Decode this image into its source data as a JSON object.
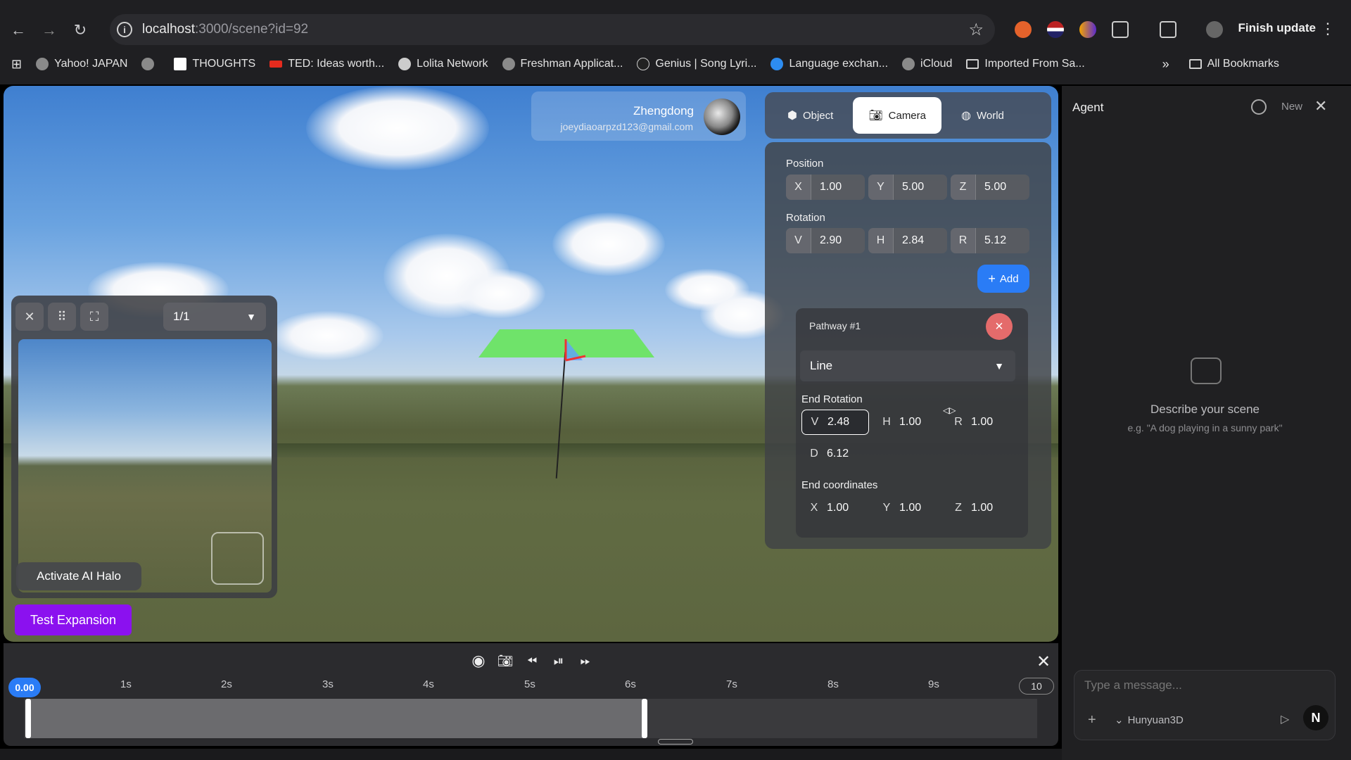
{
  "browser": {
    "url_host": "localhost",
    "url_path": ":3000/scene?id=92",
    "finish_update": "Finish update",
    "bookmarks": [
      {
        "label": "Yahoo! JAPAN"
      },
      {
        "label": "THOUGHTS"
      },
      {
        "label": "TED: Ideas worth..."
      },
      {
        "label": "Lolita Network"
      },
      {
        "label": "Freshman Applicat..."
      },
      {
        "label": "Genius | Song Lyri..."
      },
      {
        "label": "Language exchan..."
      },
      {
        "label": "iCloud"
      },
      {
        "label": "Imported From Sa..."
      }
    ],
    "all_bookmarks": "All Bookmarks"
  },
  "user": {
    "name": "Zhengdong",
    "email": "joeydiaoarpzd123@gmail.com"
  },
  "tabs": [
    {
      "label": "Object",
      "icon": "cube-icon"
    },
    {
      "label": "Camera",
      "icon": "camera-icon"
    },
    {
      "label": "World",
      "icon": "globe-icon"
    }
  ],
  "panel": {
    "position_label": "Position",
    "position": [
      {
        "axis": "X",
        "value": "1.00"
      },
      {
        "axis": "Y",
        "value": "5.00"
      },
      {
        "axis": "Z",
        "value": "5.00"
      }
    ],
    "rotation_label": "Rotation",
    "rotation": [
      {
        "axis": "V",
        "value": "2.90"
      },
      {
        "axis": "H",
        "value": "2.84"
      },
      {
        "axis": "R",
        "value": "5.12"
      }
    ],
    "add_label": "Add",
    "pathway": {
      "title": "Pathway #1",
      "type": "Line",
      "end_rotation_label": "End Rotation",
      "end_rotation": [
        {
          "axis": "V",
          "value": "2.48"
        },
        {
          "axis": "H",
          "value": "1.00"
        },
        {
          "axis": "R",
          "value": "1.00"
        }
      ],
      "d": {
        "axis": "D",
        "value": "6.12"
      },
      "end_coords_label": "End coordinates",
      "end_coords": [
        {
          "axis": "X",
          "value": "1.00"
        },
        {
          "axis": "Y",
          "value": "1.00"
        },
        {
          "axis": "Z",
          "value": "1.00"
        }
      ]
    }
  },
  "preview": {
    "page": "1/1",
    "halo_label": "Activate AI Halo"
  },
  "test_expansion": "Test Expansion",
  "timeline": {
    "start": "0.00",
    "end": "10",
    "ticks": [
      "1s",
      "2s",
      "3s",
      "4s",
      "5s",
      "6s",
      "7s",
      "8s",
      "9s"
    ]
  },
  "agent": {
    "title": "Agent",
    "new_label": "New",
    "describe": "Describe your scene",
    "example": "e.g. \"A dog playing in a sunny park\"",
    "placeholder": "Type a message...",
    "model": "Hunyuan3D",
    "avatar_letter": "N"
  }
}
